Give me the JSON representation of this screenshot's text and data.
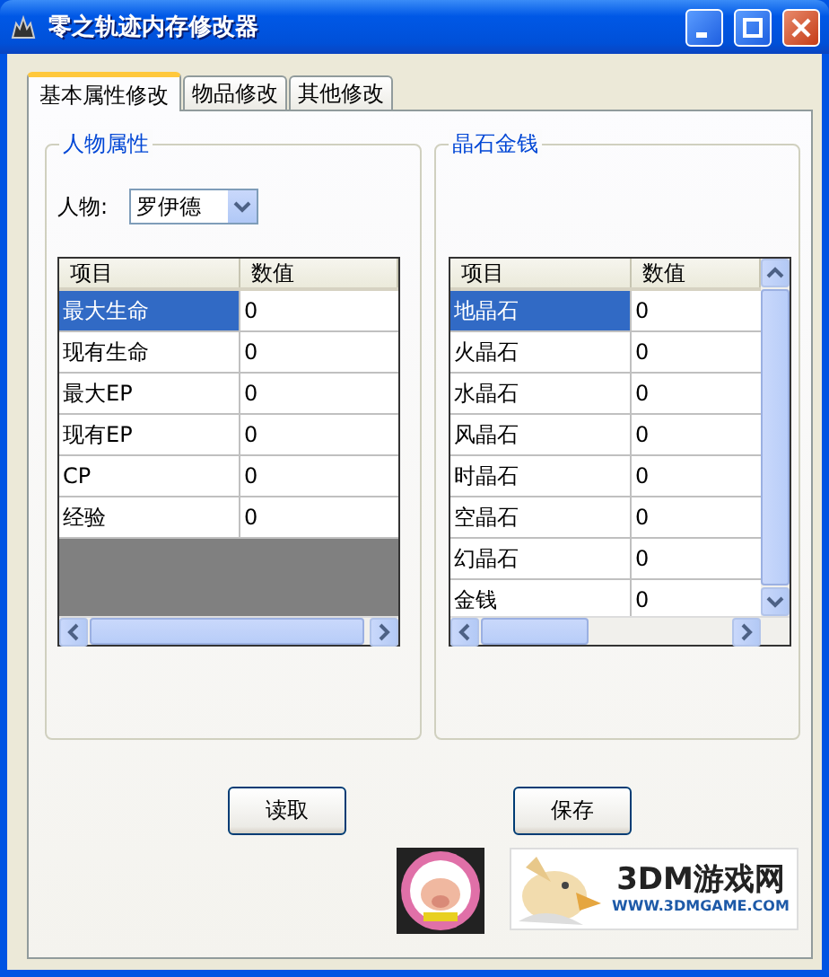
{
  "window": {
    "title": "零之轨迹内存修改器"
  },
  "tabs": [
    {
      "label": "基本属性修改",
      "selected": true
    },
    {
      "label": "物品修改",
      "selected": false
    },
    {
      "label": "其他修改",
      "selected": false
    }
  ],
  "groups": [
    {
      "title": "人物属性",
      "character": {
        "label": "人物:",
        "value": "罗伊德"
      },
      "grid": {
        "columns": [
          "项目",
          "数值"
        ],
        "rows": [
          {
            "item": "最大生命",
            "value": "0",
            "selected": true
          },
          {
            "item": "现有生命",
            "value": "0",
            "selected": false
          },
          {
            "item": "最大EP",
            "value": "0",
            "selected": false
          },
          {
            "item": "现有EP",
            "value": "0",
            "selected": false
          },
          {
            "item": "CP",
            "value": "0",
            "selected": false
          },
          {
            "item": "经验",
            "value": "0",
            "selected": false
          }
        ]
      }
    },
    {
      "title": "晶石金钱",
      "grid": {
        "columns": [
          "项目",
          "数值"
        ],
        "rows": [
          {
            "item": "地晶石",
            "value": "0",
            "selected": true
          },
          {
            "item": "火晶石",
            "value": "0",
            "selected": false
          },
          {
            "item": "水晶石",
            "value": "0",
            "selected": false
          },
          {
            "item": "风晶石",
            "value": "0",
            "selected": false
          },
          {
            "item": "时晶石",
            "value": "0",
            "selected": false
          },
          {
            "item": "空晶石",
            "value": "0",
            "selected": false
          },
          {
            "item": "幻晶石",
            "value": "0",
            "selected": false
          },
          {
            "item": "金钱",
            "value": "0",
            "selected": false
          }
        ]
      }
    }
  ],
  "buttons": [
    "读取",
    "保存"
  ],
  "banner": {
    "site": "3DM游戏网",
    "url": "WWW.3DMGAME.COM"
  }
}
